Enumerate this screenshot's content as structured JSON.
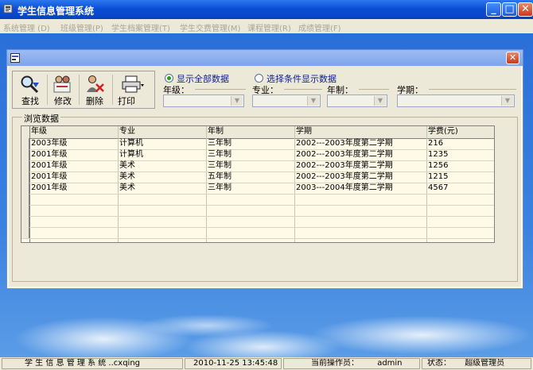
{
  "window": {
    "title": "学生信息管理系统",
    "controls": [
      "_",
      "□",
      "✕"
    ]
  },
  "menu": [
    "系统管理 (D)",
    "班级管理(P)",
    "学生档案管理(T)",
    "学生交费管理(M)",
    "课程管理(R)",
    "成绩管理(F)"
  ],
  "toolbar": {
    "find": "查找",
    "edit": "修改",
    "delete": "删除",
    "print": "打印"
  },
  "filter": {
    "show_all": "显示全部数据",
    "show_by_condition": "选择条件显示数据",
    "selected": "show_all",
    "grade_label": "年级：",
    "major_label": "专业：",
    "years_label": "年制：",
    "term_label": "学期："
  },
  "grid": {
    "legend": "浏览数据",
    "columns": [
      "年级",
      "专业",
      "年制",
      "学期",
      "学费(元)"
    ],
    "rows": [
      [
        "2003年级",
        "计算机",
        "三年制",
        "2002---2003年度第二学期",
        "216"
      ],
      [
        "2001年级",
        "计算机",
        "三年制",
        "2002---2003年度第二学期",
        "1235"
      ],
      [
        "2001年级",
        "美术",
        "三年制",
        "2002---2003年度第二学期",
        "1256"
      ],
      [
        "2001年级",
        "美术",
        "五年制",
        "2002---2003年度第二学期",
        "1215"
      ],
      [
        "2001年级",
        "美术",
        "三年制",
        "2003---2004年度第二学期",
        "4567"
      ]
    ]
  },
  "status": {
    "app": "学 生 信 息 管 理 系 统 ..cxqing",
    "datetime": "2010-11-25 13:45:48",
    "operator_label": "当前操作员：",
    "operator": "admin",
    "state_label": "状态：",
    "state": "超级管理员"
  },
  "colors": {
    "titlebar": "#0a4fd6",
    "sky": "#2a6fd8",
    "panel": "#ece9d8"
  }
}
